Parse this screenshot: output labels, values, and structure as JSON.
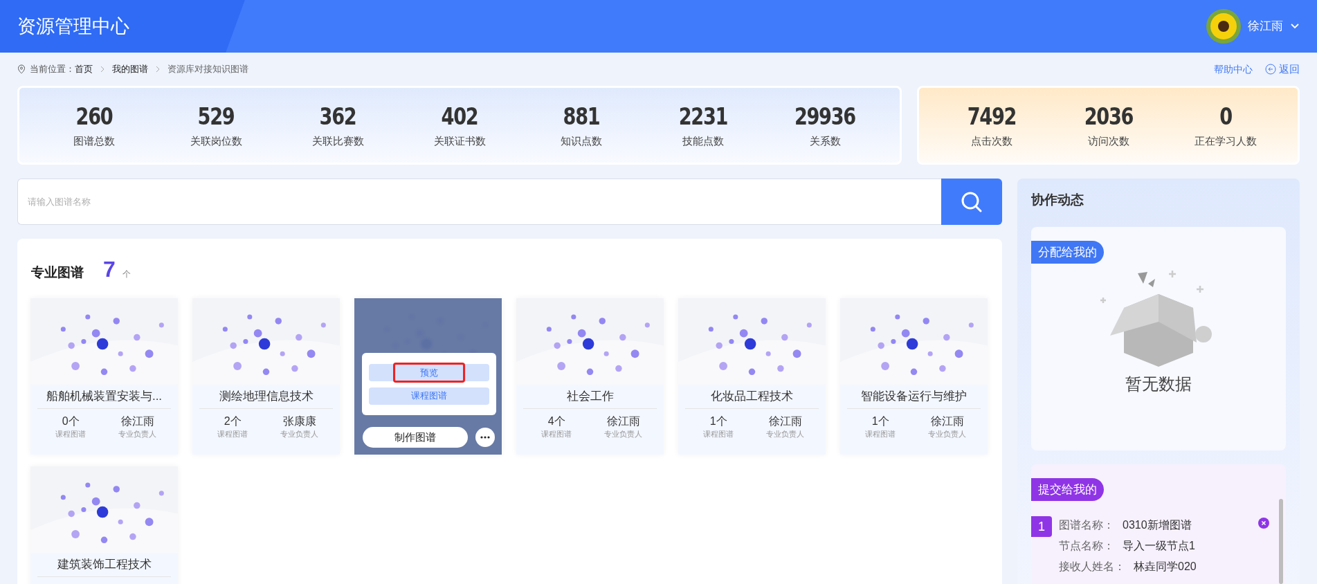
{
  "header": {
    "title": "资源管理中心",
    "user_name": "徐江雨"
  },
  "breadcrumb": {
    "label": "当前位置：",
    "items": [
      {
        "text": "首页",
        "current": false
      },
      {
        "text": "我的图谱",
        "current": false
      },
      {
        "text": "资源库对接知识图谱",
        "current": true
      }
    ]
  },
  "links": {
    "help": "帮助中心",
    "back": "返回"
  },
  "stats": [
    {
      "value": "260",
      "label": "图谱总数"
    },
    {
      "value": "529",
      "label": "关联岗位数"
    },
    {
      "value": "362",
      "label": "关联比赛数"
    },
    {
      "value": "402",
      "label": "关联证书数"
    },
    {
      "value": "881",
      "label": "知识点数"
    },
    {
      "value": "2231",
      "label": "技能点数"
    },
    {
      "value": "29936",
      "label": "关系数"
    }
  ],
  "stats_activity": [
    {
      "value": "7492",
      "label": "点击次数"
    },
    {
      "value": "2036",
      "label": "访问次数"
    },
    {
      "value": "0",
      "label": "正在学习人数"
    }
  ],
  "search": {
    "placeholder": "请输入图谱名称"
  },
  "section": {
    "title": "专业图谱",
    "count": "7",
    "unit": "个"
  },
  "cards": [
    {
      "kind": "normal",
      "title": "船舶机械装置安装与...",
      "courses": "0个",
      "courses_label": "课程图谱",
      "owner": "徐江雨",
      "owner_label": "专业负责人"
    },
    {
      "kind": "normal",
      "title": "测绘地理信息技术",
      "courses": "2个",
      "courses_label": "课程图谱",
      "owner": "张康康",
      "owner_label": "专业负责人"
    },
    {
      "kind": "hover",
      "menu": [
        {
          "label": "预览",
          "selected": true
        },
        {
          "label": "课程图谱",
          "selected": false
        }
      ],
      "action": "制作图谱"
    },
    {
      "kind": "normal",
      "title": "社会工作",
      "courses": "4个",
      "courses_label": "课程图谱",
      "owner": "徐江雨",
      "owner_label": "专业负责人"
    },
    {
      "kind": "normal",
      "title": "化妆品工程技术",
      "courses": "1个",
      "courses_label": "课程图谱",
      "owner": "徐江雨",
      "owner_label": "专业负责人"
    },
    {
      "kind": "normal",
      "title": "智能设备运行与维护",
      "courses": "1个",
      "courses_label": "课程图谱",
      "owner": "徐江雨",
      "owner_label": "专业负责人"
    },
    {
      "kind": "cut",
      "title": "建筑装饰工程技术"
    }
  ],
  "collab": {
    "title": "协作动态",
    "assigned": {
      "label": "分配给我的",
      "empty": "暂无数据"
    },
    "submitted": {
      "label": "提交给我的",
      "items": [
        {
          "index": "1",
          "fields": [
            {
              "label": "图谱名称：",
              "value": "0310新增图谱"
            },
            {
              "label": "节点名称：",
              "value": "导入一级节点1"
            },
            {
              "label": "接收人姓名：",
              "value": "林垚同学020"
            }
          ]
        }
      ]
    }
  }
}
